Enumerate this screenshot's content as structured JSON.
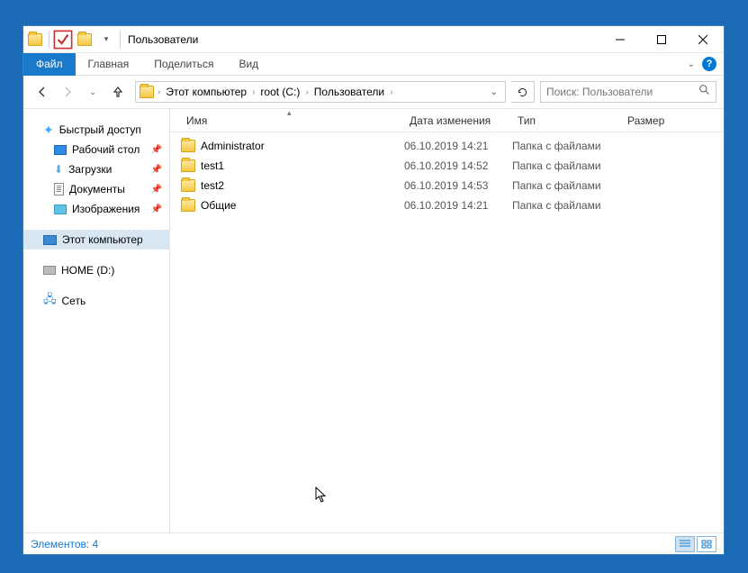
{
  "window": {
    "title": "Пользователи"
  },
  "ribbon": {
    "file": "Файл",
    "tabs": [
      "Главная",
      "Поделиться",
      "Вид"
    ]
  },
  "breadcrumbs": [
    "Этот компьютер",
    "root (C:)",
    "Пользователи"
  ],
  "search": {
    "placeholder": "Поиск: Пользователи"
  },
  "sidebar": {
    "quick": "Быстрый доступ",
    "items": [
      {
        "label": "Рабочий стол",
        "pinned": true
      },
      {
        "label": "Загрузки",
        "pinned": true
      },
      {
        "label": "Документы",
        "pinned": true
      },
      {
        "label": "Изображения",
        "pinned": true
      }
    ],
    "thispc": "Этот компьютер",
    "drive": "HOME (D:)",
    "network": "Сеть"
  },
  "columns": {
    "name": "Имя",
    "date": "Дата изменения",
    "type": "Тип",
    "size": "Размер"
  },
  "rows": [
    {
      "name": "Administrator",
      "date": "06.10.2019 14:21",
      "type": "Папка с файлами"
    },
    {
      "name": "test1",
      "date": "06.10.2019 14:52",
      "type": "Папка с файлами"
    },
    {
      "name": "test2",
      "date": "06.10.2019 14:53",
      "type": "Папка с файлами"
    },
    {
      "name": "Общие",
      "date": "06.10.2019 14:21",
      "type": "Папка с файлами"
    }
  ],
  "status": {
    "label": "Элементов:",
    "count": "4"
  }
}
